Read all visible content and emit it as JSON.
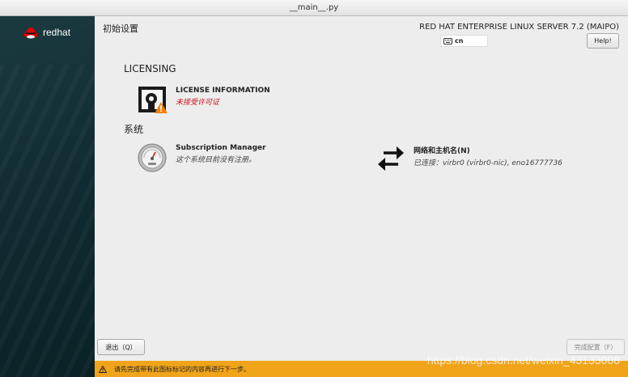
{
  "window": {
    "title": "__main__.py"
  },
  "sidebar": {
    "brand": "redhat"
  },
  "header": {
    "page_title": "初始设置",
    "product": "RED HAT ENTERPRISE LINUX SERVER 7.2 (MAIPO)",
    "keyboard_layout": "cn",
    "help_label": "Help!"
  },
  "sections": [
    {
      "title": "LICENSING",
      "spokes": [
        {
          "title": "LICENSE INFORMATION",
          "status": "未接受许可证",
          "icon": "license-warning-icon"
        }
      ]
    },
    {
      "title": "系统",
      "spokes": [
        {
          "title": "Subscription Manager",
          "status": "这个系统目前没有注册。",
          "icon": "gauge-icon"
        },
        {
          "title": "网络和主机名(N)",
          "status": "已连接：virbr0 (virbr0-nic), eno16777736",
          "icon": "network-arrows-icon"
        }
      ]
    }
  ],
  "footer": {
    "quit_label": "退出（Q）",
    "done_label": "完成配置（F）",
    "warning": "请先完成带有此图标标记的内容再进行下一步。"
  },
  "watermark": "https://blog.csdn.net/weixin_43133008",
  "colors": {
    "warning_bar": "#f0a41a",
    "status_warning": "#c5161e",
    "sidebar": "#12303a"
  }
}
